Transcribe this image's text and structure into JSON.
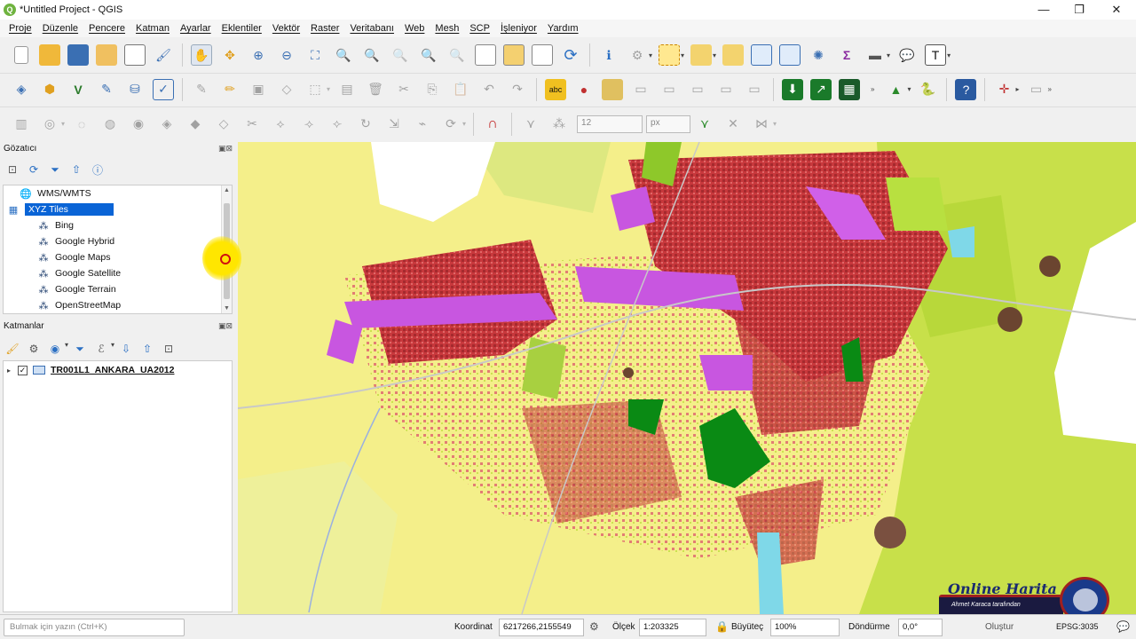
{
  "window": {
    "title": "*Untitled Project - QGIS",
    "app_icon": "qgis-logo",
    "minimize": "—",
    "maximize": "❐",
    "close": "✕"
  },
  "menu": [
    "Proje",
    "Düzenle",
    "Pencere",
    "Katman",
    "Ayarlar",
    "Eklentiler",
    "Vektör",
    "Raster",
    "Veritabanı",
    "Web",
    "Mesh",
    "SCP",
    "İşleniyor",
    "Yardım"
  ],
  "toolbar3": {
    "font_size": "12",
    "unit": "px"
  },
  "browser": {
    "title": "Gözatıcı",
    "items": [
      {
        "label": "WMS/WMTS",
        "icon": "globe-icon",
        "indent": 1
      },
      {
        "label": "XYZ Tiles",
        "icon": "xyz-tiles-icon",
        "indent": 0,
        "selected": true
      },
      {
        "label": "Bing",
        "icon": "tile-icon",
        "indent": 2
      },
      {
        "label": "Google Hybrid",
        "icon": "tile-icon",
        "indent": 2
      },
      {
        "label": "Google Maps",
        "icon": "tile-icon",
        "indent": 2
      },
      {
        "label": "Google Satellite",
        "icon": "tile-icon",
        "indent": 2
      },
      {
        "label": "Google Terrain",
        "icon": "tile-icon",
        "indent": 2
      },
      {
        "label": "OpenStreetMap",
        "icon": "tile-icon",
        "indent": 2
      }
    ]
  },
  "layers": {
    "title": "Katmanlar",
    "items": [
      {
        "name": "TR001L1_ANKARA_UA2012",
        "checked": true
      }
    ]
  },
  "status": {
    "locator_placeholder": "Bulmak için yazın (Ctrl+K)",
    "coord_label": "Koordinat",
    "coord_value": "6217266,2155549",
    "scale_label": "Ölçek",
    "scale_value": "1:203325",
    "magnifier_label": "Büyüteç",
    "magnifier_value": "100%",
    "rotation_label": "Döndürme",
    "rotation_value": "0,0°",
    "render_label": "Oluştur",
    "crs": "EPSG:3035"
  },
  "watermark": {
    "title": "Online Harita",
    "subtitle": "Ahmet Karaca tarafından"
  },
  "colors": {
    "urban_red": "#c8383c",
    "industrial_purple": "#c856e0",
    "agriculture_yellow": "#f4ef8a",
    "pasture_green": "#c8e04a",
    "forest_green": "#0a8a14",
    "water_blue": "#7fd8e8",
    "selection_blue": "#0a64d6"
  }
}
